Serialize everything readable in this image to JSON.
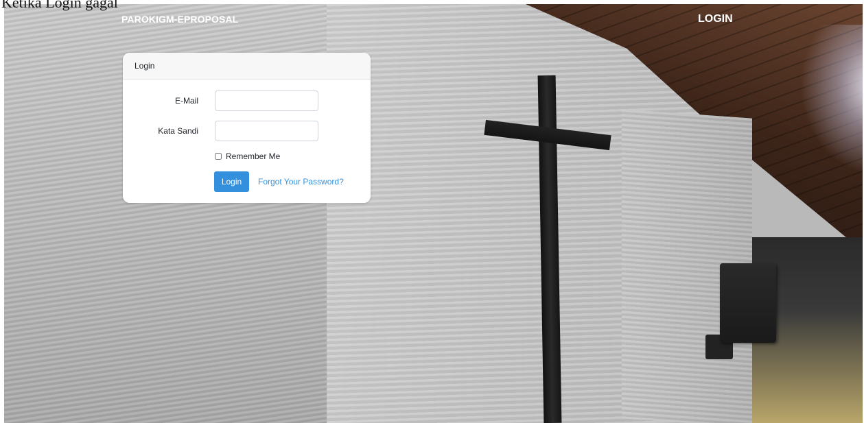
{
  "caption": "Ketika Login gagal",
  "navbar": {
    "brand": "PAROKIGM-EPROPOSAL",
    "login_link": "LOGIN"
  },
  "login_card": {
    "header": "Login",
    "email_label": "E-Mail",
    "email_value": "",
    "password_label": "Kata Sandi",
    "password_value": "",
    "remember_label": "Remember Me",
    "remember_checked": false,
    "login_button": "Login",
    "forgot_link": "Forgot Your Password?"
  },
  "colors": {
    "primary": "#3490dc",
    "card_header_bg": "#f7f7f7",
    "navbar_text": "#ffffff"
  }
}
